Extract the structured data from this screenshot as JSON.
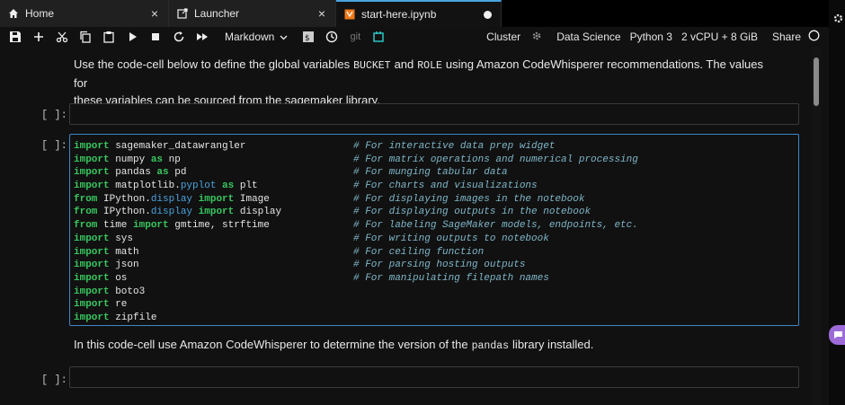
{
  "tabs": [
    {
      "label": "Home",
      "icon": "home-icon",
      "close": "×"
    },
    {
      "label": "Launcher",
      "icon": "launcher-icon",
      "close": "×"
    },
    {
      "label": "start-here.ipynb",
      "icon": "notebook-icon",
      "modified": true
    }
  ],
  "toolbar": {
    "cell_type": "Markdown",
    "git_label": "git",
    "cluster": "Cluster",
    "image": "Data Science",
    "kernel": "Python 3",
    "instance": "2 vCPU + 8 GiB",
    "share": "Share"
  },
  "cells": {
    "md1": {
      "pre": "Use the code-cell below to define the global variables",
      "code1": "BUCKET",
      "and": "and",
      "code2": "ROLE",
      "post": "using Amazon CodeWhisperer recommendations. The values for",
      "line2": "these variables can be sourced from the sagemaker library."
    },
    "prompt1": "[ ]:",
    "prompt2": "[ ]:",
    "prompt3": "[ ]:",
    "code_lines": [
      {
        "kw1": "import",
        "name": " sagemaker_datawrangler",
        "kw2": "",
        "attr": "",
        "rest": "",
        "comment": "# For interactive data prep widget"
      },
      {
        "kw1": "import",
        "name": " numpy ",
        "kw2": "as",
        "attr": "",
        "rest": " np",
        "comment": "# For matrix operations and numerical processing"
      },
      {
        "kw1": "import",
        "name": " pandas ",
        "kw2": "as",
        "attr": "",
        "rest": " pd",
        "comment": "# For munging tabular data"
      },
      {
        "kw1": "import",
        "name": " matplotlib.",
        "kw2": "",
        "attr": "pyplot",
        "rest": " as plt",
        "comment": "# For charts and visualizations"
      },
      {
        "kw1": "from",
        "name": " IPython.",
        "kw2": "",
        "attr": "display",
        "rest": " import Image",
        "comment": "# For displaying images in the notebook"
      },
      {
        "kw1": "from",
        "name": " IPython.",
        "kw2": "",
        "attr": "display",
        "rest": " import display",
        "comment": "# For displaying outputs in the notebook"
      },
      {
        "kw1": "from",
        "name": " time ",
        "kw2": "import",
        "attr": "",
        "rest": " gmtime, strftime",
        "comment": "# For labeling SageMaker models, endpoints, etc."
      },
      {
        "kw1": "import",
        "name": " sys",
        "kw2": "",
        "attr": "",
        "rest": "",
        "comment": "# For writing outputs to notebook"
      },
      {
        "kw1": "import",
        "name": " math",
        "kw2": "",
        "attr": "",
        "rest": "",
        "comment": "# For ceiling function"
      },
      {
        "kw1": "import",
        "name": " json",
        "kw2": "",
        "attr": "",
        "rest": "",
        "comment": "# For parsing hosting outputs"
      },
      {
        "kw1": "import",
        "name": " os",
        "kw2": "",
        "attr": "",
        "rest": "",
        "comment": "# For manipulating filepath names"
      },
      {
        "kw1": "import",
        "name": " boto3",
        "kw2": "",
        "attr": "",
        "rest": "",
        "comment": ""
      },
      {
        "kw1": "import",
        "name": " re",
        "kw2": "",
        "attr": "",
        "rest": "",
        "comment": ""
      },
      {
        "kw1": "import",
        "name": " zipfile",
        "kw2": "",
        "attr": "",
        "rest": "",
        "comment": ""
      }
    ],
    "md2": {
      "pre": "In this code-cell use Amazon CodeWhisperer to determine the version of the",
      "code": "pandas",
      "post": "library installed."
    }
  },
  "colors": {
    "keyword": "#39c75f",
    "attribute": "#4aa3df",
    "comment": "#7fb6c8",
    "active_border": "#3f86c7",
    "assistant": "#9d6bd8"
  }
}
